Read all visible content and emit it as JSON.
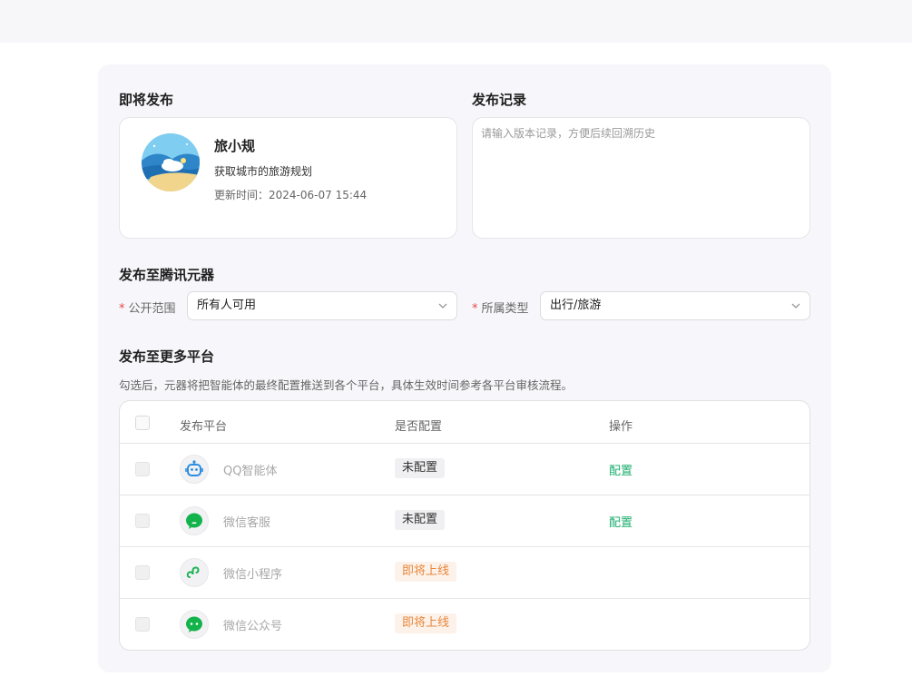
{
  "upcoming": {
    "title": "即将发布",
    "agent_name": "旅小规",
    "agent_desc": "获取城市的旅游规划",
    "update_label": "更新时间：",
    "update_time": "2024-06-07 15:44"
  },
  "record": {
    "title": "发布记录",
    "placeholder": "请输入版本记录，方便后续回溯历史"
  },
  "tencent": {
    "title": "发布至腾讯元器",
    "scope_label": "公开范围",
    "scope_value": "所有人可用",
    "type_label": "所属类型",
    "type_value": "出行/旅游",
    "required_mark": "*"
  },
  "more": {
    "title": "发布至更多平台",
    "hint": "勾选后，元器将把智能体的最终配置推送到各个平台，具体生效时间参考各平台审核流程。",
    "columns": [
      "发布平台",
      "是否配置",
      "操作"
    ],
    "rows": [
      {
        "name": "QQ智能体",
        "status": "未配置",
        "action": "配置",
        "icon": "qq-bot-icon"
      },
      {
        "name": "微信客服",
        "status": "未配置",
        "action": "配置",
        "icon": "wechat-service-icon"
      },
      {
        "name": "微信小程序",
        "status": "即将上线",
        "action": "",
        "icon": "wechat-miniprogram-icon"
      },
      {
        "name": "微信公众号",
        "status": "即将上线",
        "action": "",
        "icon": "wechat-official-icon"
      }
    ]
  },
  "colors": {
    "accent_green": "#1aad6b",
    "orange": "#e8863a",
    "required_red": "#e54545"
  }
}
